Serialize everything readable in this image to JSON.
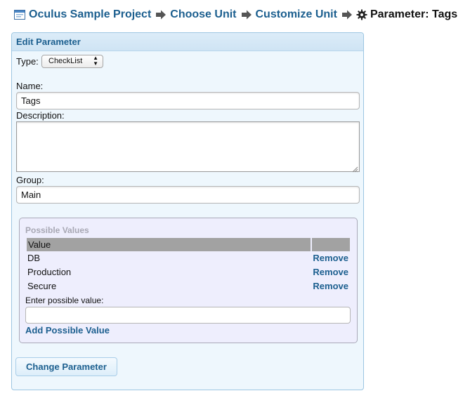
{
  "breadcrumb": {
    "project": "Oculus Sample Project",
    "choose_unit": "Choose Unit",
    "customize_unit": "Customize Unit",
    "current": "Parameter: Tags"
  },
  "icons": {
    "project": "project-window-icon",
    "separator": "arrow-right-icon",
    "current": "gear-icon"
  },
  "panel": {
    "title": "Edit Parameter"
  },
  "form": {
    "type_label": "Type:",
    "type_value": "CheckList",
    "name_label": "Name:",
    "name_value": "Tags",
    "description_label": "Description:",
    "description_value": "",
    "group_label": "Group:",
    "group_value": "Main"
  },
  "possible_values": {
    "title": "Possible Values",
    "column_header": "Value",
    "rows": [
      {
        "value": "DB",
        "action": "Remove"
      },
      {
        "value": "Production",
        "action": "Remove"
      },
      {
        "value": "Secure",
        "action": "Remove"
      }
    ],
    "enter_label": "Enter possible value:",
    "enter_value": "",
    "add_label": "Add Possible Value"
  },
  "submit_label": "Change Parameter",
  "colors": {
    "link": "#1c5f8f",
    "panel_bg": "#eef7fd",
    "panel_border": "#9cc6e2",
    "pv_bg": "#eeeefd",
    "table_header": "#a2a2a2"
  }
}
